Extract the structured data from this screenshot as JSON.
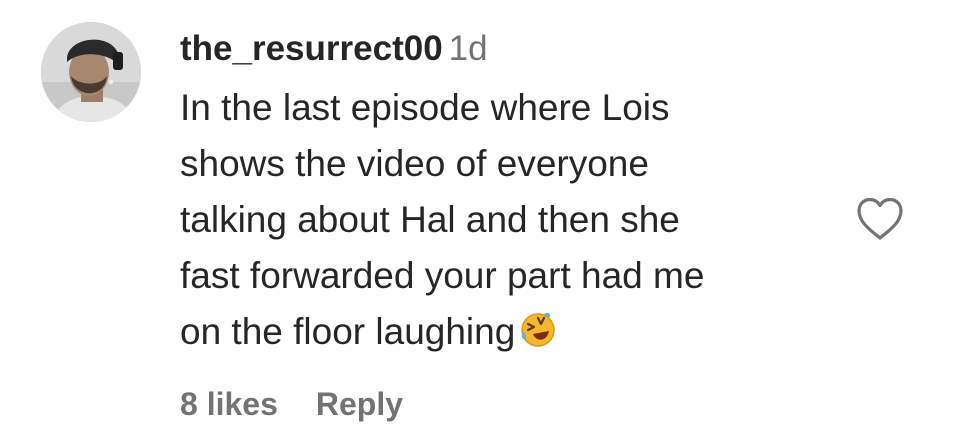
{
  "comment": {
    "username": "the_resurrect00",
    "timestamp": "1d",
    "lines": [
      "In the last episode where Lois",
      "shows the video of everyone",
      "talking about Hal and then she",
      "fast forwarded your part had me",
      "on the floor laughing"
    ],
    "emoji": "rolling-on-the-floor-laughing-emoji",
    "likes_label": "8 likes",
    "reply_label": "Reply",
    "like_icon": "heart-icon"
  },
  "colors": {
    "text": "#262626",
    "secondary": "#737373",
    "emoji_face": "#f5b72f"
  }
}
